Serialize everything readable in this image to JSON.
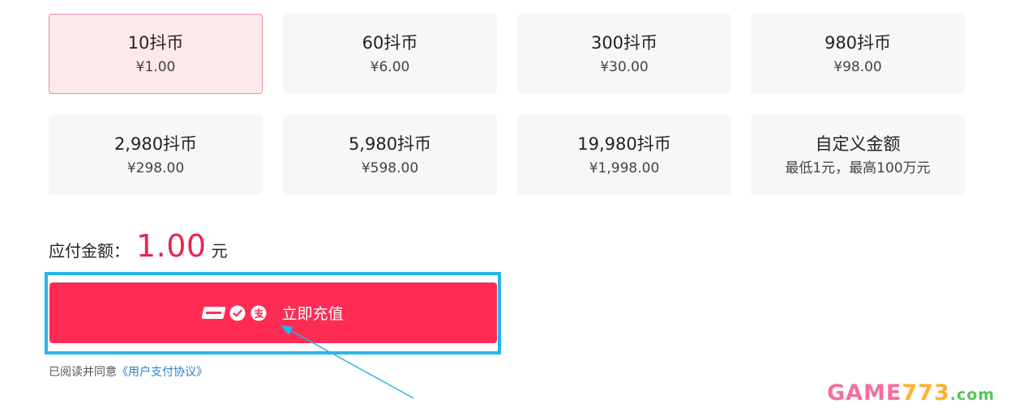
{
  "packages": [
    {
      "coins": "10抖币",
      "price": "¥1.00",
      "selected": true
    },
    {
      "coins": "60抖币",
      "price": "¥6.00",
      "selected": false
    },
    {
      "coins": "300抖币",
      "price": "¥30.00",
      "selected": false
    },
    {
      "coins": "980抖币",
      "price": "¥98.00",
      "selected": false
    },
    {
      "coins": "2,980抖币",
      "price": "¥298.00",
      "selected": false
    },
    {
      "coins": "5,980抖币",
      "price": "¥598.00",
      "selected": false
    },
    {
      "coins": "19,980抖币",
      "price": "¥1,998.00",
      "selected": false
    },
    {
      "coins": "自定义金额",
      "price": "最低1元，最高100万元",
      "selected": false
    }
  ],
  "payment": {
    "label": "应付金额：",
    "amount": "1.00",
    "unit": "元",
    "button_label": "立即充值",
    "icons": [
      "unionpay-icon",
      "wechat-pay-icon",
      "alipay-icon"
    ]
  },
  "agreement": {
    "prefix": "已阅读并同意",
    "link_text": "《用户支付协议》"
  },
  "watermark": {
    "part1": "GAME",
    "part2": "773",
    "part3": ".com"
  },
  "colors": {
    "accent": "#fe2c55",
    "amount": "#e8264d",
    "selected_bg": "#fde9ec",
    "selected_border": "#ee8a9a",
    "card_bg": "#f7f7f7",
    "highlight": "#26b5e8",
    "link": "#2f7ec9"
  }
}
